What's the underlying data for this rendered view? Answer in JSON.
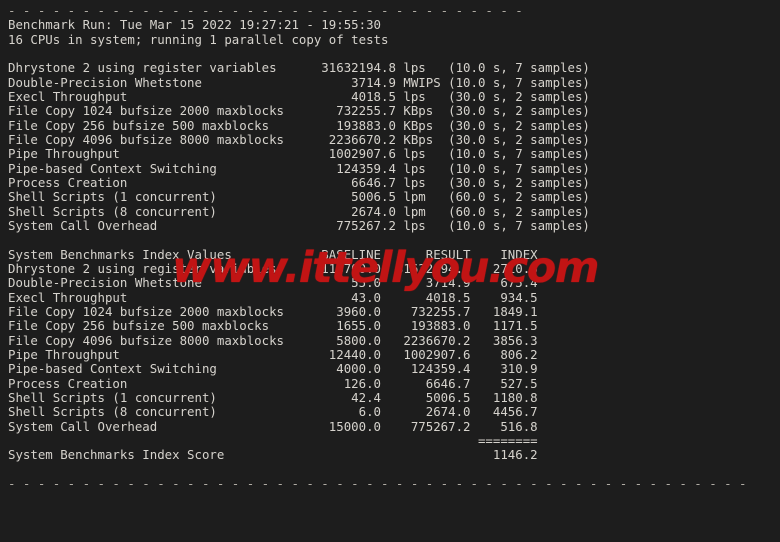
{
  "terminal": {
    "background_color": "#1d1d1d",
    "text_color": "#d6d3cd",
    "top_rule": "- - - - - - - - - - - - - - - - - - - - - - - - - - - - - - - - - - -",
    "bottom_rule": "- - - - - - - - - - - - - - - - - - - - - - - - - - - - - - - - - - - - - - - - - - - - - - - - - -"
  },
  "watermark": {
    "text": "www.ittellyou.com",
    "color": "#c11414"
  },
  "header": {
    "run_line": "Benchmark Run: Tue Mar 15 2022 19:27:21 - 19:55:30",
    "cpu_line": "16 CPUs in system; running 1 parallel copy of tests"
  },
  "raw_results": {
    "rows": [
      {
        "name": "Dhrystone 2 using register variables",
        "value": "31632194.8",
        "unit": "lps",
        "timing": "(10.0 s, 7 samples)"
      },
      {
        "name": "Double-Precision Whetstone",
        "value": "3714.9",
        "unit": "MWIPS",
        "timing": "(10.0 s, 7 samples)"
      },
      {
        "name": "Execl Throughput",
        "value": "4018.5",
        "unit": "lps",
        "timing": "(30.0 s, 2 samples)"
      },
      {
        "name": "File Copy 1024 bufsize 2000 maxblocks",
        "value": "732255.7",
        "unit": "KBps",
        "timing": "(30.0 s, 2 samples)"
      },
      {
        "name": "File Copy 256 bufsize 500 maxblocks",
        "value": "193883.0",
        "unit": "KBps",
        "timing": "(30.0 s, 2 samples)"
      },
      {
        "name": "File Copy 4096 bufsize 8000 maxblocks",
        "value": "2236670.2",
        "unit": "KBps",
        "timing": "(30.0 s, 2 samples)"
      },
      {
        "name": "Pipe Throughput",
        "value": "1002907.6",
        "unit": "lps",
        "timing": "(10.0 s, 7 samples)"
      },
      {
        "name": "Pipe-based Context Switching",
        "value": "124359.4",
        "unit": "lps",
        "timing": "(10.0 s, 7 samples)"
      },
      {
        "name": "Process Creation",
        "value": "6646.7",
        "unit": "lps",
        "timing": "(30.0 s, 2 samples)"
      },
      {
        "name": "Shell Scripts (1 concurrent)",
        "value": "5006.5",
        "unit": "lpm",
        "timing": "(60.0 s, 2 samples)"
      },
      {
        "name": "Shell Scripts (8 concurrent)",
        "value": "2674.0",
        "unit": "lpm",
        "timing": "(60.0 s, 2 samples)"
      },
      {
        "name": "System Call Overhead",
        "value": "775267.2",
        "unit": "lps",
        "timing": "(10.0 s, 7 samples)"
      }
    ]
  },
  "index_table": {
    "title": "System Benchmarks Index Values",
    "columns": [
      "BASELINE",
      "RESULT",
      "INDEX"
    ],
    "rows": [
      {
        "name": "Dhrystone 2 using register variables",
        "baseline": "116700.0",
        "result": "31632194.8",
        "index": "2710.6"
      },
      {
        "name": "Double-Precision Whetstone",
        "baseline": "55.0",
        "result": "3714.9",
        "index": "675.4"
      },
      {
        "name": "Execl Throughput",
        "baseline": "43.0",
        "result": "4018.5",
        "index": "934.5"
      },
      {
        "name": "File Copy 1024 bufsize 2000 maxblocks",
        "baseline": "3960.0",
        "result": "732255.7",
        "index": "1849.1"
      },
      {
        "name": "File Copy 256 bufsize 500 maxblocks",
        "baseline": "1655.0",
        "result": "193883.0",
        "index": "1171.5"
      },
      {
        "name": "File Copy 4096 bufsize 8000 maxblocks",
        "baseline": "5800.0",
        "result": "2236670.2",
        "index": "3856.3"
      },
      {
        "name": "Pipe Throughput",
        "baseline": "12440.0",
        "result": "1002907.6",
        "index": "806.2"
      },
      {
        "name": "Pipe-based Context Switching",
        "baseline": "4000.0",
        "result": "124359.4",
        "index": "310.9"
      },
      {
        "name": "Process Creation",
        "baseline": "126.0",
        "result": "6646.7",
        "index": "527.5"
      },
      {
        "name": "Shell Scripts (1 concurrent)",
        "baseline": "42.4",
        "result": "5006.5",
        "index": "1180.8"
      },
      {
        "name": "Shell Scripts (8 concurrent)",
        "baseline": "6.0",
        "result": "2674.0",
        "index": "4456.7"
      },
      {
        "name": "System Call Overhead",
        "baseline": "15000.0",
        "result": "775267.2",
        "index": "516.8"
      }
    ],
    "separator": "========",
    "score_label": "System Benchmarks Index Score",
    "score_value": "1146.2"
  }
}
